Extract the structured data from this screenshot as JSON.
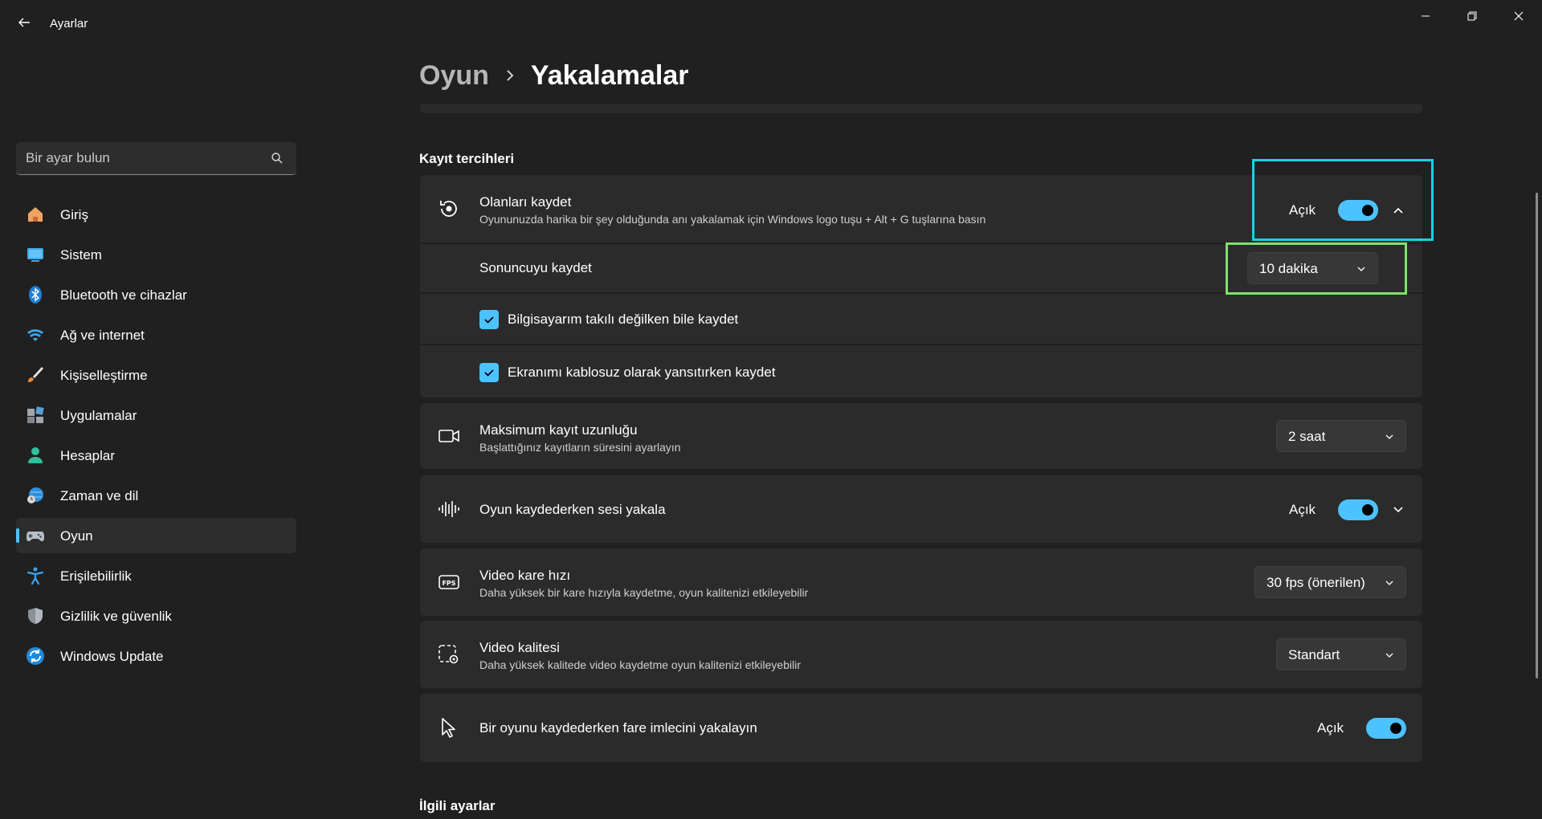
{
  "app": {
    "title": "Ayarlar"
  },
  "search": {
    "placeholder": "Bir ayar bulun"
  },
  "sidebar": {
    "items": [
      {
        "label": "Giriş",
        "icon": "home-icon"
      },
      {
        "label": "Sistem",
        "icon": "system-icon"
      },
      {
        "label": "Bluetooth ve cihazlar",
        "icon": "bluetooth-icon"
      },
      {
        "label": "Ağ ve internet",
        "icon": "wifi-icon"
      },
      {
        "label": "Kişiselleştirme",
        "icon": "brush-icon"
      },
      {
        "label": "Uygulamalar",
        "icon": "apps-icon"
      },
      {
        "label": "Hesaplar",
        "icon": "person-icon"
      },
      {
        "label": "Zaman ve dil",
        "icon": "globe-clock-icon"
      },
      {
        "label": "Oyun",
        "icon": "gamepad-icon",
        "active": true
      },
      {
        "label": "Erişilebilirlik",
        "icon": "accessibility-icon"
      },
      {
        "label": "Gizlilik ve güvenlik",
        "icon": "shield-icon"
      },
      {
        "label": "Windows Update",
        "icon": "update-icon"
      }
    ]
  },
  "breadcrumb": {
    "parent": "Oyun",
    "current": "Yakalamalar"
  },
  "sections": {
    "recording": "Kayıt tercihleri",
    "related": "İlgili ayarlar"
  },
  "record_what_happened": {
    "title": "Olanları kaydet",
    "subtitle": "Oyununuzda harika bir şey olduğunda anı yakalamak için Windows logo tuşu + Alt + G tuşlarına basın",
    "toggle_label": "Açık",
    "toggle_on": true,
    "record_last_label": "Sonuncuyu kaydet",
    "record_last_value": "10 dakika",
    "checkbox_unplugged": "Bilgisayarım takılı değilken bile kaydet",
    "checkbox_wireless": "Ekranımı kablosuz olarak yansıtırken kaydet"
  },
  "max_length": {
    "title": "Maksimum kayıt uzunluğu",
    "subtitle": "Başlattığınız kayıtların süresini ayarlayın",
    "value": "2 saat"
  },
  "audio": {
    "title": "Oyun kaydederken sesi yakala",
    "toggle_label": "Açık",
    "toggle_on": true
  },
  "frame_rate": {
    "title": "Video kare hızı",
    "subtitle": "Daha yüksek bir kare hızıyla kaydetme, oyun kalitenizi etkileyebilir",
    "value": "30 fps (önerilen)"
  },
  "quality": {
    "title": "Video kalitesi",
    "subtitle": "Daha yüksek kalitede video kaydetme oyun kalitenizi etkileyebilir",
    "value": "Standart"
  },
  "cursor": {
    "title": "Bir oyunu kaydederken fare imlecini yakalayın",
    "toggle_label": "Açık",
    "toggle_on": true
  },
  "colors": {
    "accent": "#4cc2ff",
    "background": "#202020",
    "card": "#2b2b2b"
  }
}
